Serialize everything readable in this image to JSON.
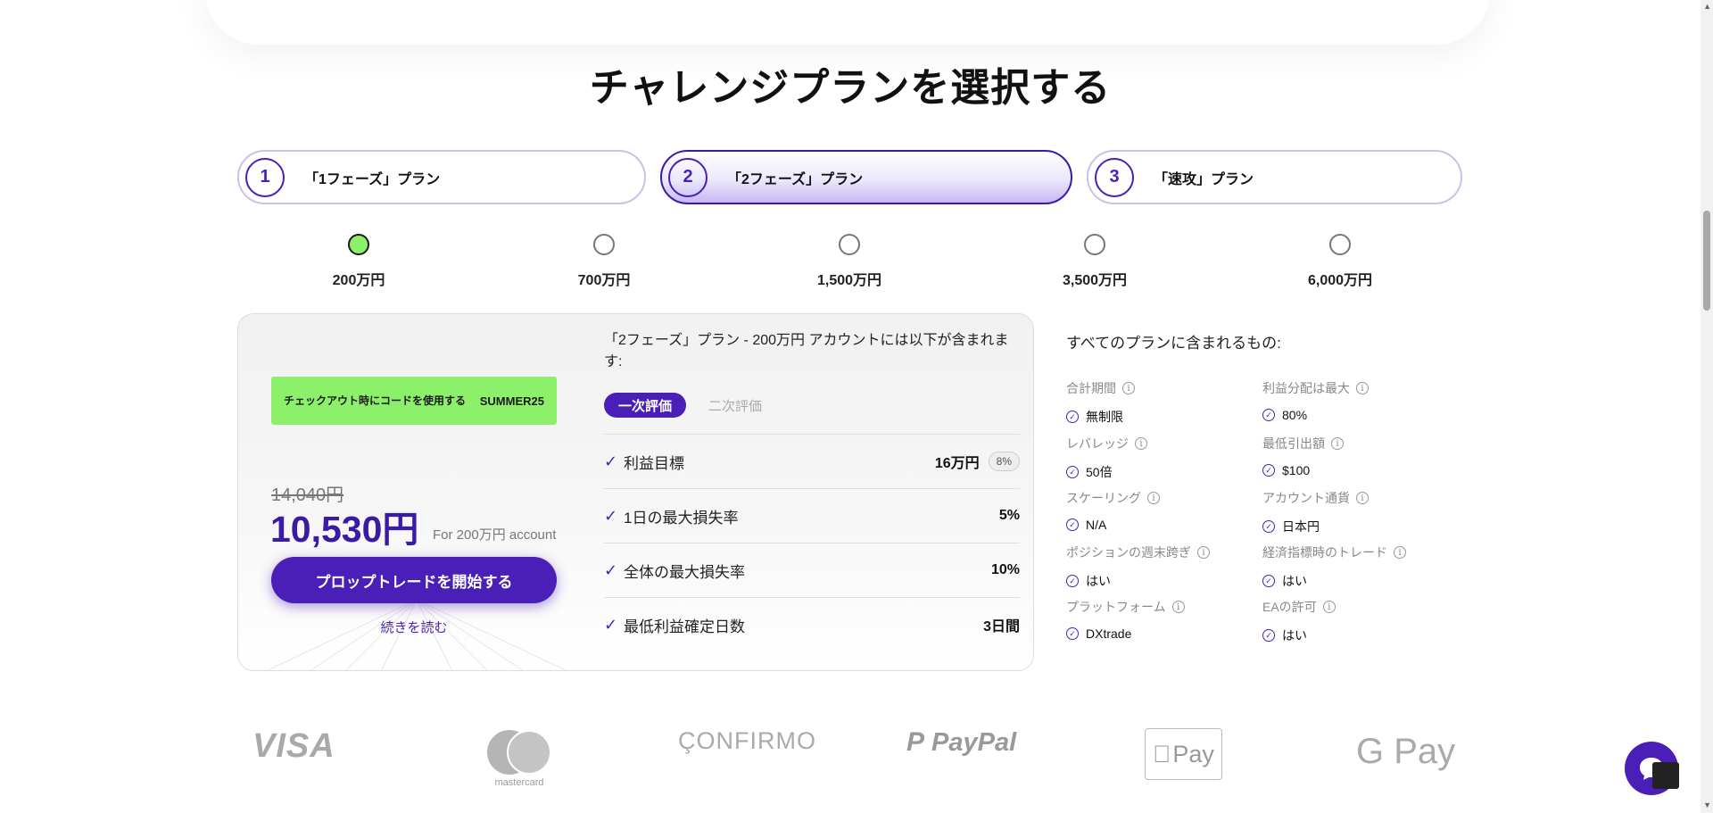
{
  "title": "チャレンジプランを選択する",
  "tabs": [
    {
      "num": "1",
      "label": "「1フェーズ」プラン"
    },
    {
      "num": "2",
      "label": "「2フェーズ」プラン"
    },
    {
      "num": "3",
      "label": "「速攻」プラン"
    }
  ],
  "active_tab": "2",
  "amounts": [
    "200万円",
    "700万円",
    "1,500万円",
    "3,500万円",
    "6,000万円"
  ],
  "selected_amount": "200万円",
  "card": {
    "promo_text": "チェックアウト時にコードを使用する",
    "promo_code": "SUMMER25",
    "old_price": "14,040円",
    "price": "10,530円",
    "for_account": "For 200万円 account",
    "start_button": "プロップトレードを開始する",
    "read_more": "続きを読む",
    "includes_heading": "「2フェーズ」プラン - 200万円 アカウントには以下が含まれます:",
    "eval_tab_1": "一次評価",
    "eval_tab_2": "二次評価",
    "rows": [
      {
        "label": "利益目標",
        "value": "16万円",
        "badge": "8%"
      },
      {
        "label": "1日の最大損失率",
        "value": "5%"
      },
      {
        "label": "全体の最大損失率",
        "value": "10%"
      },
      {
        "label": "最低利益確定日数",
        "value": "3日間"
      }
    ]
  },
  "all_plans": {
    "heading": "すべてのプランに含まれるもの:",
    "features": [
      {
        "label": "合計期間",
        "value": "無制限"
      },
      {
        "label": "利益分配は最大",
        "value": "80%"
      },
      {
        "label": "レバレッジ",
        "value": "50倍"
      },
      {
        "label": "最低引出額",
        "value": "$100"
      },
      {
        "label": "スケーリング",
        "value": "N/A"
      },
      {
        "label": "アカウント通貨",
        "value": "日本円"
      },
      {
        "label": "ポジションの週末跨ぎ",
        "value": "はい"
      },
      {
        "label": "経済指標時のトレード",
        "value": "はい"
      },
      {
        "label": "プラットフォーム",
        "value": "DXtrade"
      },
      {
        "label": "EAの許可",
        "value": "はい"
      }
    ]
  },
  "payments": {
    "visa": "VISA",
    "mastercard": "mastercard",
    "confirmo": "ÇONFIRMO",
    "paypal": "PayPal",
    "applepay": "Pay",
    "gpay": "G Pay"
  },
  "icons": {
    "check": "check-icon",
    "info": "info-icon",
    "chat": "chat-icon"
  },
  "colors": {
    "accent": "#4a1fb8",
    "promo": "#8df06a"
  }
}
